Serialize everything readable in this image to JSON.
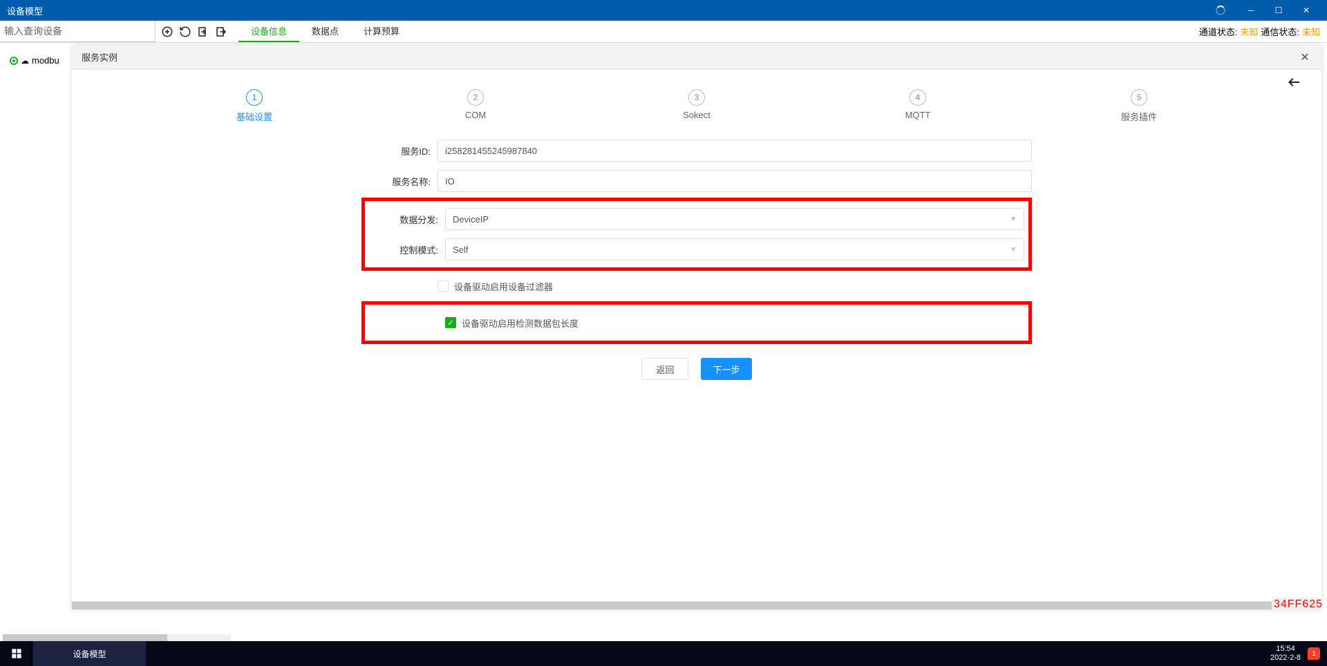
{
  "window": {
    "title": "设备模型"
  },
  "toolbar": {
    "search_placeholder": "输入查询设备",
    "tabs": [
      {
        "label": "设备信息",
        "active": true
      },
      {
        "label": "数据点",
        "active": false
      },
      {
        "label": "计算预算",
        "active": false
      }
    ],
    "status": [
      {
        "label": "通道状态:",
        "value": "未知"
      },
      {
        "label": "通信状态:",
        "value": "未知"
      }
    ]
  },
  "tree": {
    "items": [
      {
        "label": "modbu"
      }
    ]
  },
  "dialog": {
    "title": "服务实例",
    "steps": [
      {
        "num": "1",
        "label": "基础设置",
        "active": true
      },
      {
        "num": "2",
        "label": "COM",
        "active": false
      },
      {
        "num": "3",
        "label": "Sokect",
        "active": false
      },
      {
        "num": "4",
        "label": "MQTT",
        "active": false
      },
      {
        "num": "5",
        "label": "服务插件",
        "active": false
      }
    ],
    "form": {
      "service_id_label": "服务ID:",
      "service_id_value": "i258281455245987840",
      "service_name_label": "服务名称:",
      "service_name_value": "IO",
      "data_dispatch_label": "数据分发:",
      "data_dispatch_value": "DeviceIP",
      "control_mode_label": "控制模式:",
      "control_mode_value": "Self",
      "checkbox1_label": "设备驱动启用设备过滤器",
      "checkbox1_checked": false,
      "checkbox2_label": "设备驱动启用检测数据包长度",
      "checkbox2_checked": true
    },
    "buttons": {
      "back": "返回",
      "next": "下一步"
    }
  },
  "watermark": "34FF625",
  "taskbar": {
    "app": "设备模型",
    "time": "15:54",
    "date": "2022-2-8",
    "notif_count": "1"
  }
}
